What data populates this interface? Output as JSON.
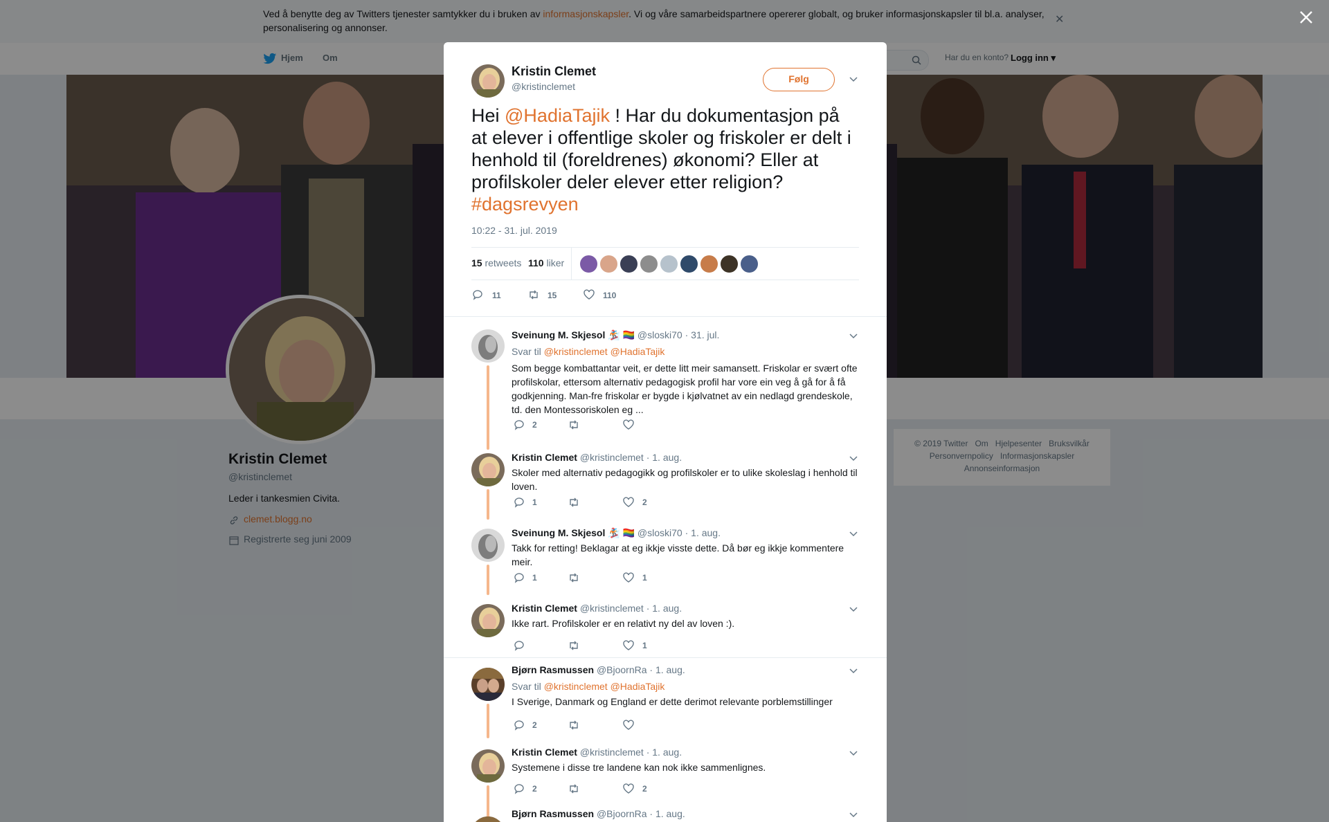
{
  "cookie": {
    "text_before": "Ved å benytte deg av Twitters tjenester samtykker du i bruken av ",
    "link": "informasjonskapsler",
    "text_after": ". Vi og våre samarbeidspartnere opererer globalt, og bruker informasjonskapsler til bl.a. analyser, personalisering og annonser."
  },
  "nav": {
    "home": "Hjem",
    "about": "Om",
    "login_question": "Har du en konto?",
    "login": "Logg inn"
  },
  "profile": {
    "name": "Kristin Clemet",
    "handle": "@kristinclemet",
    "bio": "Leder i tankesmien Civita.",
    "link": "clemet.blogg.no",
    "joined": "Registrerte seg juni 2009"
  },
  "footer": {
    "items": [
      "© 2019 Twitter",
      "Om",
      "Hjelpesenter",
      "Bruksvilkår",
      "Personvernpolicy",
      "Informasjonskapsler",
      "Annonseinformasjon"
    ]
  },
  "tweet": {
    "name": "Kristin Clemet",
    "handle": "@kristinclemet",
    "follow": "Følg",
    "text_1": "Hei ",
    "mention": "@HadiaTajik",
    "text_2": " ! Har du dokumentasjon på at elever i offentlige skoler og friskoler er delt i henhold til (foreldrenes) økonomi? Eller at profilskoler deler elever etter religion? ",
    "hashtag": "#dagsrevyen",
    "time": "10:22 - 31. jul. 2019",
    "retweets_count": "15",
    "retweets_label": "retweets",
    "likes_count": "110",
    "likes_label": "liker",
    "reply_count": "11",
    "retweet_action_count": "15",
    "like_action_count": "110",
    "liker_colors": [
      "#7b5aa6",
      "#d9a58a",
      "#3a3f55",
      "#8d8d8d",
      "#b6c2cc",
      "#2f4a6a",
      "#c77c4a",
      "#3d3326",
      "#4a5f8a"
    ]
  },
  "replies": [
    {
      "name": "Sveinung M. Skjesol",
      "emoji": "🏂 🏳️‍🌈",
      "handle": "@sloski70",
      "date": "· 31. jul.",
      "reply_to_label": "Svar til",
      "reply_to": "@kristinclemet @HadiaTajik",
      "text": "Som begge kombattantar veit, er dette litt meir samansett. Friskolar er svært ofte profilskolar, ettersom alternativ pedagogisk profil har vore ein veg å gå for å få godkjenning. Man-fre friskolar er bygde i kjølvatnet av ein nedlagd grendeskole, td. den Montessoriskolen eg ...",
      "replies": "2",
      "retweets": "",
      "likes": ""
    },
    {
      "name": "Kristin Clemet",
      "handle": "@kristinclemet",
      "date": "· 1. aug.",
      "text": "Skoler med alternativ pedagogikk og profilskoler er to ulike skoleslag i henhold til loven.",
      "replies": "1",
      "retweets": "",
      "likes": "2"
    },
    {
      "name": "Sveinung M. Skjesol",
      "emoji": "🏂 🏳️‍🌈",
      "handle": "@sloski70",
      "date": "· 1. aug.",
      "text": "Takk for retting! Beklagar at eg ikkje visste dette. Då bør eg ikkje kommentere meir.",
      "replies": "1",
      "retweets": "",
      "likes": "1"
    },
    {
      "name": "Kristin Clemet",
      "handle": "@kristinclemet",
      "date": "· 1. aug.",
      "text": "Ikke rart. Profilskoler er en relativt ny del av loven :).",
      "replies": "",
      "retweets": "",
      "likes": "1"
    },
    {
      "name": "Bjørn Rasmussen",
      "handle": "@BjoornRa",
      "date": "· 1. aug.",
      "reply_to_label": "Svar til",
      "reply_to": "@kristinclemet @HadiaTajik",
      "text": "I Sverige, Danmark og England er dette derimot relevante porblemstillinger",
      "replies": "2",
      "retweets": "",
      "likes": ""
    },
    {
      "name": "Kristin Clemet",
      "handle": "@kristinclemet",
      "date": "· 1. aug.",
      "text": "Systemene i disse tre landene kan nok ikke sammenlignes.",
      "replies": "2",
      "retweets": "",
      "likes": "2"
    },
    {
      "name": "Bjørn Rasmussen",
      "handle": "@BjoornRa",
      "date": "· 1. aug."
    }
  ],
  "colors": {
    "accent": "#e0732f",
    "thread_line": "#f5b78c",
    "muted": "#657786"
  }
}
